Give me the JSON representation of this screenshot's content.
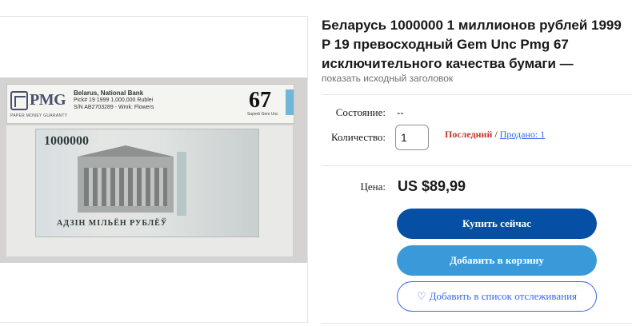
{
  "listing": {
    "title": "Беларусь 1000000 1 миллионов рублей 1999 P 19 превосходный Gem Unc Pmg 67 исключительного качества бумаги —",
    "show_original_title": "показать исходный заголовок"
  },
  "image": {
    "slab_logo": "PMG",
    "slab_subtitle": "PAPER MONEY GUARANTY",
    "slab_lines": [
      "Belarus, National Bank",
      "Pick# 19  1999  1,000,000 Rublei",
      "S/N AB2703289 - Wmk: Flowers"
    ],
    "grade": "67",
    "grade_label": "Superb Gem Unc",
    "note_denomination": "1000000",
    "note_text": "АДЗІН МІЛЬЁН РУБЛЁЎ"
  },
  "details": {
    "condition_label": "Состояние:",
    "condition_value": "--",
    "quantity_label": "Количество:",
    "quantity_value": "1",
    "last_label": "Последний",
    "separator": "/",
    "sold_label": "Продано: 1"
  },
  "pricing": {
    "price_label": "Цена:",
    "price_value": "US $89,99"
  },
  "actions": {
    "buy_now": "Купить сейчас",
    "add_to_cart": "Добавить в корзину",
    "watchlist": "Добавить в список отслеживания",
    "watchlist_icon": "heart-icon"
  },
  "colors": {
    "buy_button": "#0550a5",
    "cart_button": "#3a9ad9",
    "link": "#3665f3",
    "last_item": "#c0392b"
  }
}
